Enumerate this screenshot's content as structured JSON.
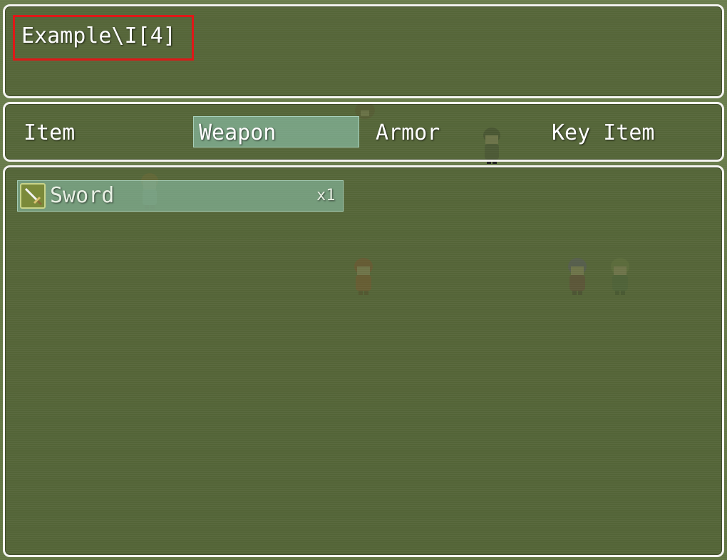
{
  "help_window": {
    "text": "Example\\I[4]"
  },
  "categories": [
    {
      "label": "Item",
      "selected": false
    },
    {
      "label": "Weapon",
      "selected": true
    },
    {
      "label": "Armor",
      "selected": false
    },
    {
      "label": "Key Item",
      "selected": false
    }
  ],
  "items": [
    {
      "icon": "sword-icon",
      "name": "Sword",
      "quantity": "x1",
      "selected": true
    }
  ],
  "colors": {
    "window_border": "#f4f4f0",
    "highlight_box": "#e01818",
    "selection": "#96d2be",
    "background": "#657946"
  },
  "map_characters": [
    {
      "name": "character-sprite-orange-hair",
      "icon": "character-sprite"
    },
    {
      "name": "character-sprite-brown-hair",
      "icon": "character-sprite"
    },
    {
      "name": "character-sprite-black-hair",
      "icon": "character-sprite"
    },
    {
      "name": "character-sprite-red-hair",
      "icon": "character-sprite"
    },
    {
      "name": "character-sprite-purple-hair",
      "icon": "character-sprite"
    },
    {
      "name": "character-sprite-green-hair",
      "icon": "character-sprite"
    }
  ]
}
